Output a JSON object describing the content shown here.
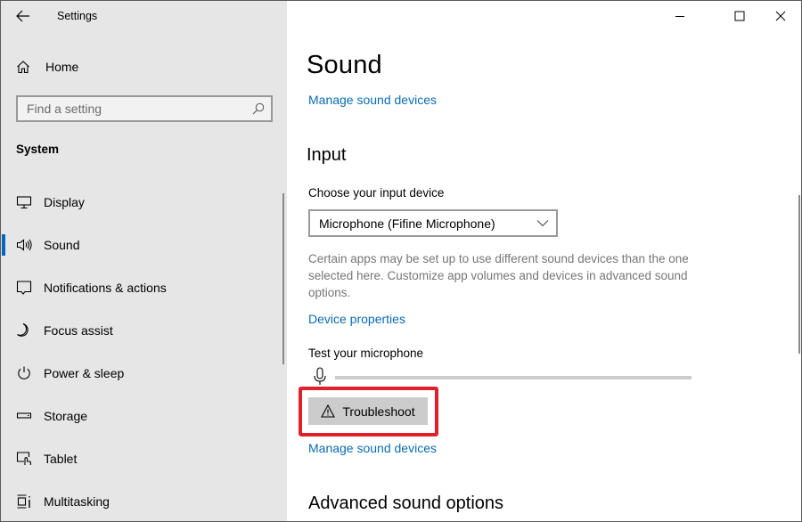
{
  "window": {
    "title": "Settings",
    "controls": {
      "minimize": "minimize-icon",
      "maximize": "maximize-icon",
      "close": "close-icon"
    }
  },
  "sidebar": {
    "back_icon": "arrow-left-icon",
    "home": {
      "label": "Home",
      "icon": "home-icon"
    },
    "search": {
      "placeholder": "Find a setting",
      "icon": "search-icon"
    },
    "section_title": "System",
    "items": [
      {
        "label": "Display",
        "icon": "monitor-icon",
        "selected": false
      },
      {
        "label": "Sound",
        "icon": "speaker-icon",
        "selected": true
      },
      {
        "label": "Notifications & actions",
        "icon": "notification-icon",
        "selected": false
      },
      {
        "label": "Focus assist",
        "icon": "moon-icon",
        "selected": false
      },
      {
        "label": "Power & sleep",
        "icon": "power-icon",
        "selected": false
      },
      {
        "label": "Storage",
        "icon": "storage-icon",
        "selected": false
      },
      {
        "label": "Tablet",
        "icon": "tablet-icon",
        "selected": false
      },
      {
        "label": "Multitasking",
        "icon": "multitasking-icon",
        "selected": false
      }
    ]
  },
  "main": {
    "title": "Sound",
    "manage_devices_top": "Manage sound devices",
    "input_heading": "Input",
    "choose_label": "Choose your input device",
    "input_device": "Microphone (Fifine  Microphone)",
    "description": "Certain apps may be set up to use different sound devices than the one selected here. Customize app volumes and devices in advanced sound options.",
    "device_properties": "Device properties",
    "test_label": "Test your microphone",
    "mic_level": 0,
    "troubleshoot_label": "Troubleshoot",
    "troubleshoot_icon": "warning-icon",
    "manage_devices_bottom": "Manage sound devices",
    "advanced_heading": "Advanced sound options"
  },
  "colors": {
    "accent": "#0067c0",
    "link": "#0a6bb8",
    "highlight": "#e0202a",
    "sidebar_bg": "#e6e6e6"
  }
}
